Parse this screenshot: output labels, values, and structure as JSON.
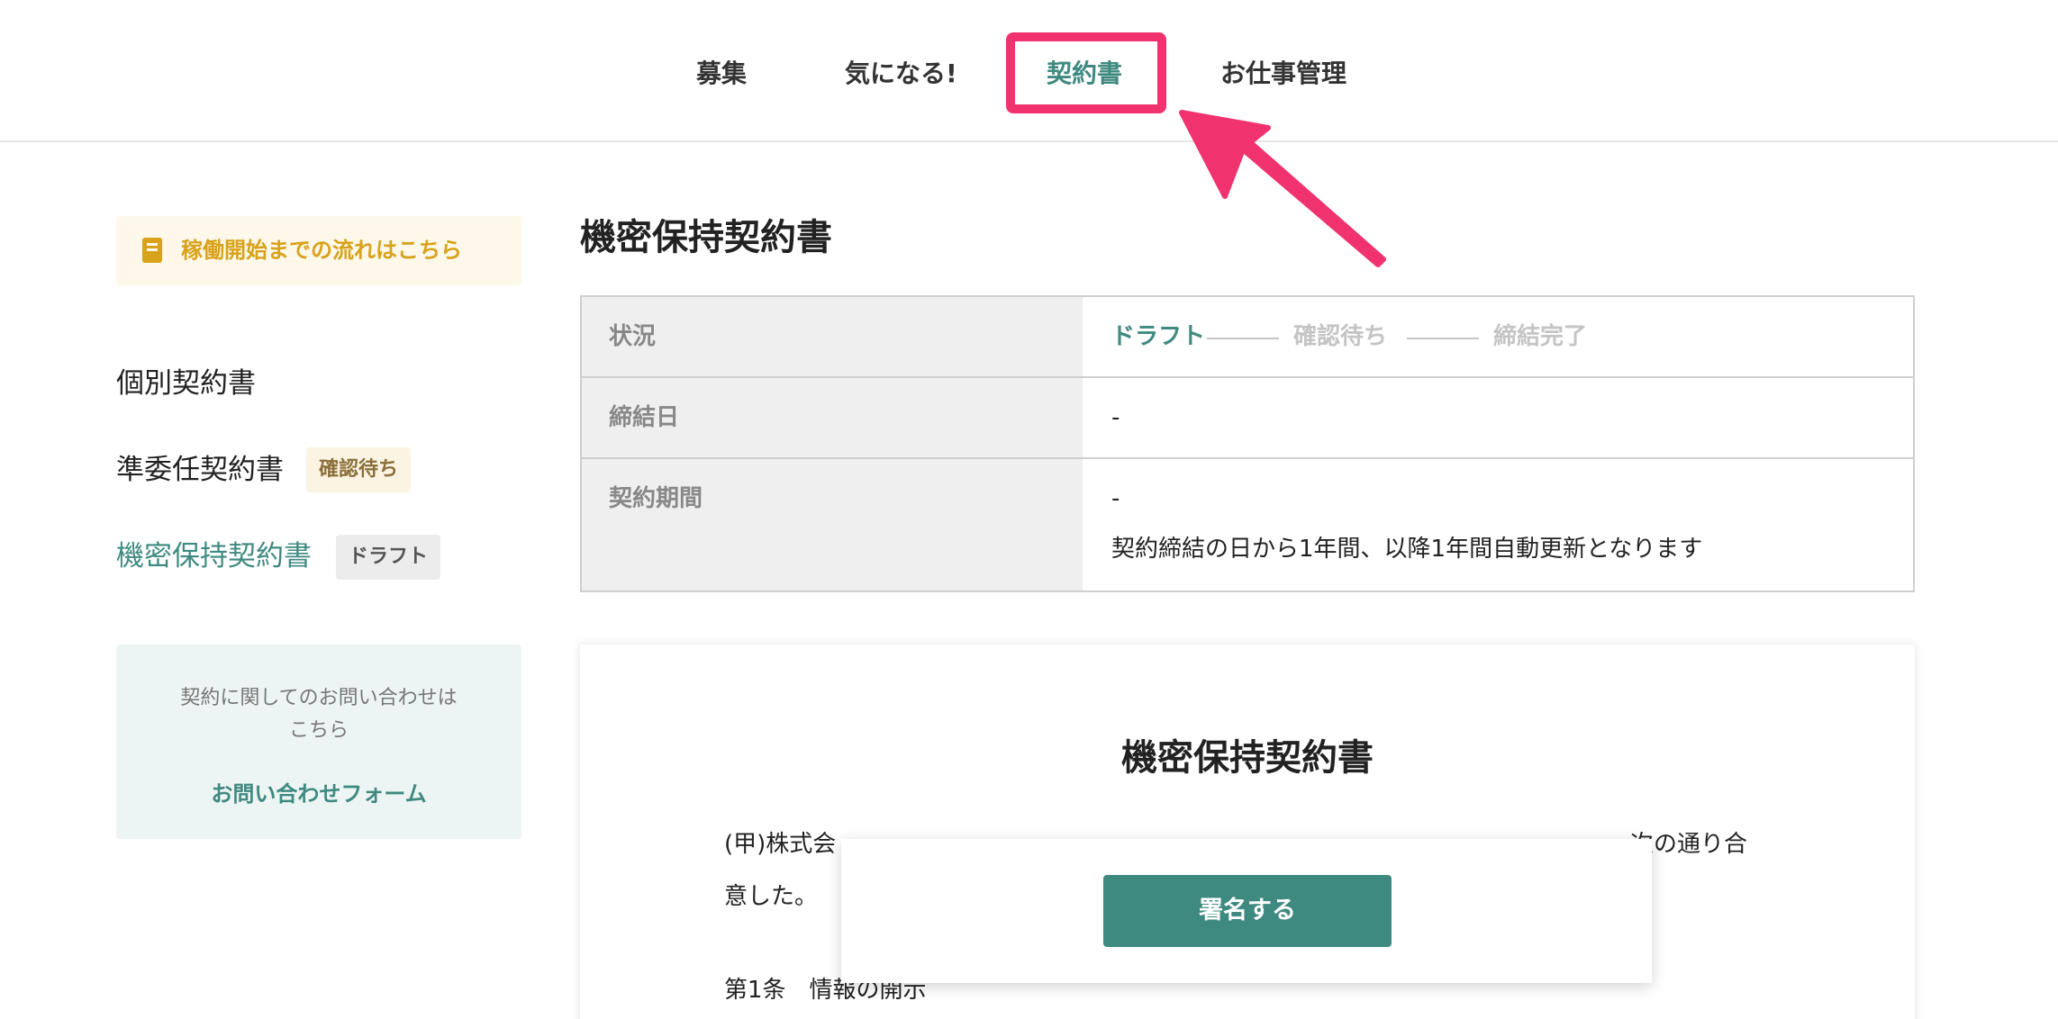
{
  "nav": {
    "items": [
      {
        "label": "募集"
      },
      {
        "label": "気になる!"
      },
      {
        "label": "契約書"
      },
      {
        "label": "お仕事管理"
      }
    ],
    "active_index": 2
  },
  "sidebar": {
    "flow_banner": {
      "label": "稼働開始までの流れはこちら",
      "icon": "book-icon"
    },
    "links": [
      {
        "label": "個別契約書"
      },
      {
        "label": "準委任契約書",
        "badge": "確認待ち"
      },
      {
        "label": "機密保持契約書",
        "badge": "ドラフト"
      }
    ],
    "contact": {
      "text_line1": "契約に関してのお問い合わせは",
      "text_line2": "こちら",
      "link": "お問い合わせフォーム"
    }
  },
  "main": {
    "title": "機密保持契約書",
    "info": {
      "status_label": "状況",
      "steps": [
        "ドラフト",
        "確認待ち",
        "締結完了"
      ],
      "current_step": 0,
      "date_label": "締結日",
      "date_value": "-",
      "period_label": "契約期間",
      "period_value": "-",
      "period_note": "契約締結の日から1年間、以降1年間自動更新となります"
    },
    "document": {
      "title": "機密保持契約書",
      "para1_start": "(甲)株式会",
      "para1_end": "次の通り合",
      "para1_line2": "意した。",
      "article1": "第1条　情報の開示"
    },
    "sign_button": "署名する"
  },
  "colors": {
    "accent": "#3f8a80",
    "highlight": "#f0336f",
    "banner_text": "#d8a21a"
  }
}
